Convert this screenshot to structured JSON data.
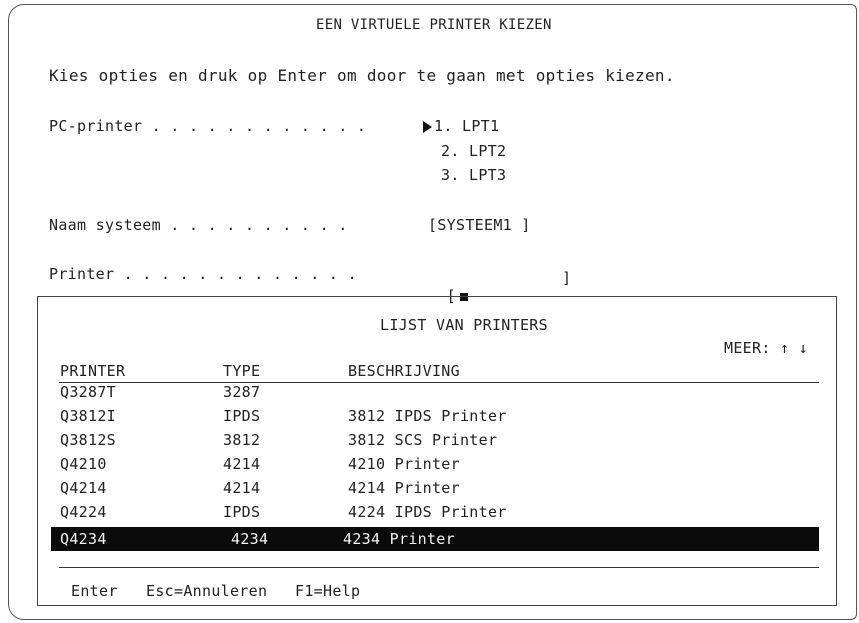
{
  "screen": {
    "title": "EEN VIRTUELE PRINTER KIEZEN",
    "instruction": "Kies opties en druk op Enter om door te gaan met opties kiezen."
  },
  "form": {
    "pc_printer": {
      "label": "PC-printer . . . . . . . . . . . .",
      "options": [
        "1. LPT1",
        "2. LPT2",
        "3. LPT3"
      ],
      "selected_index": 0
    },
    "system_name": {
      "label": "Naam systeem . . . . . . . . . .",
      "value": "[SYSTEEM1 ]"
    },
    "printer": {
      "label": "Printer . . . . . . . . . . . . .",
      "open_bracket": "[",
      "close_bracket": "]"
    }
  },
  "popup": {
    "title": "LIJST VAN PRINTERS",
    "more_label": "MEER:",
    "more_arrows": "↑ ↓",
    "columns": [
      "PRINTER",
      "TYPE",
      "BESCHRIJVING"
    ],
    "rows": [
      {
        "printer": "Q3287T",
        "type": "3287",
        "description": ""
      },
      {
        "printer": "Q3812I",
        "type": "IPDS",
        "description": "3812 IPDS Printer"
      },
      {
        "printer": "Q3812S",
        "type": "3812",
        "description": "3812 SCS Printer"
      },
      {
        "printer": "Q4210",
        "type": "4214",
        "description": "4210 Printer"
      },
      {
        "printer": "Q4214",
        "type": "4214",
        "description": "4214 Printer"
      },
      {
        "printer": "Q4224",
        "type": "IPDS",
        "description": "4224 IPDS Printer"
      },
      {
        "printer": "Q4234",
        "type": "4234",
        "description": "4234 Printer"
      }
    ],
    "selected_row": 6,
    "footer": {
      "enter": "Enter",
      "cancel": "Esc=Annuleren",
      "help": "F1=Help"
    }
  }
}
